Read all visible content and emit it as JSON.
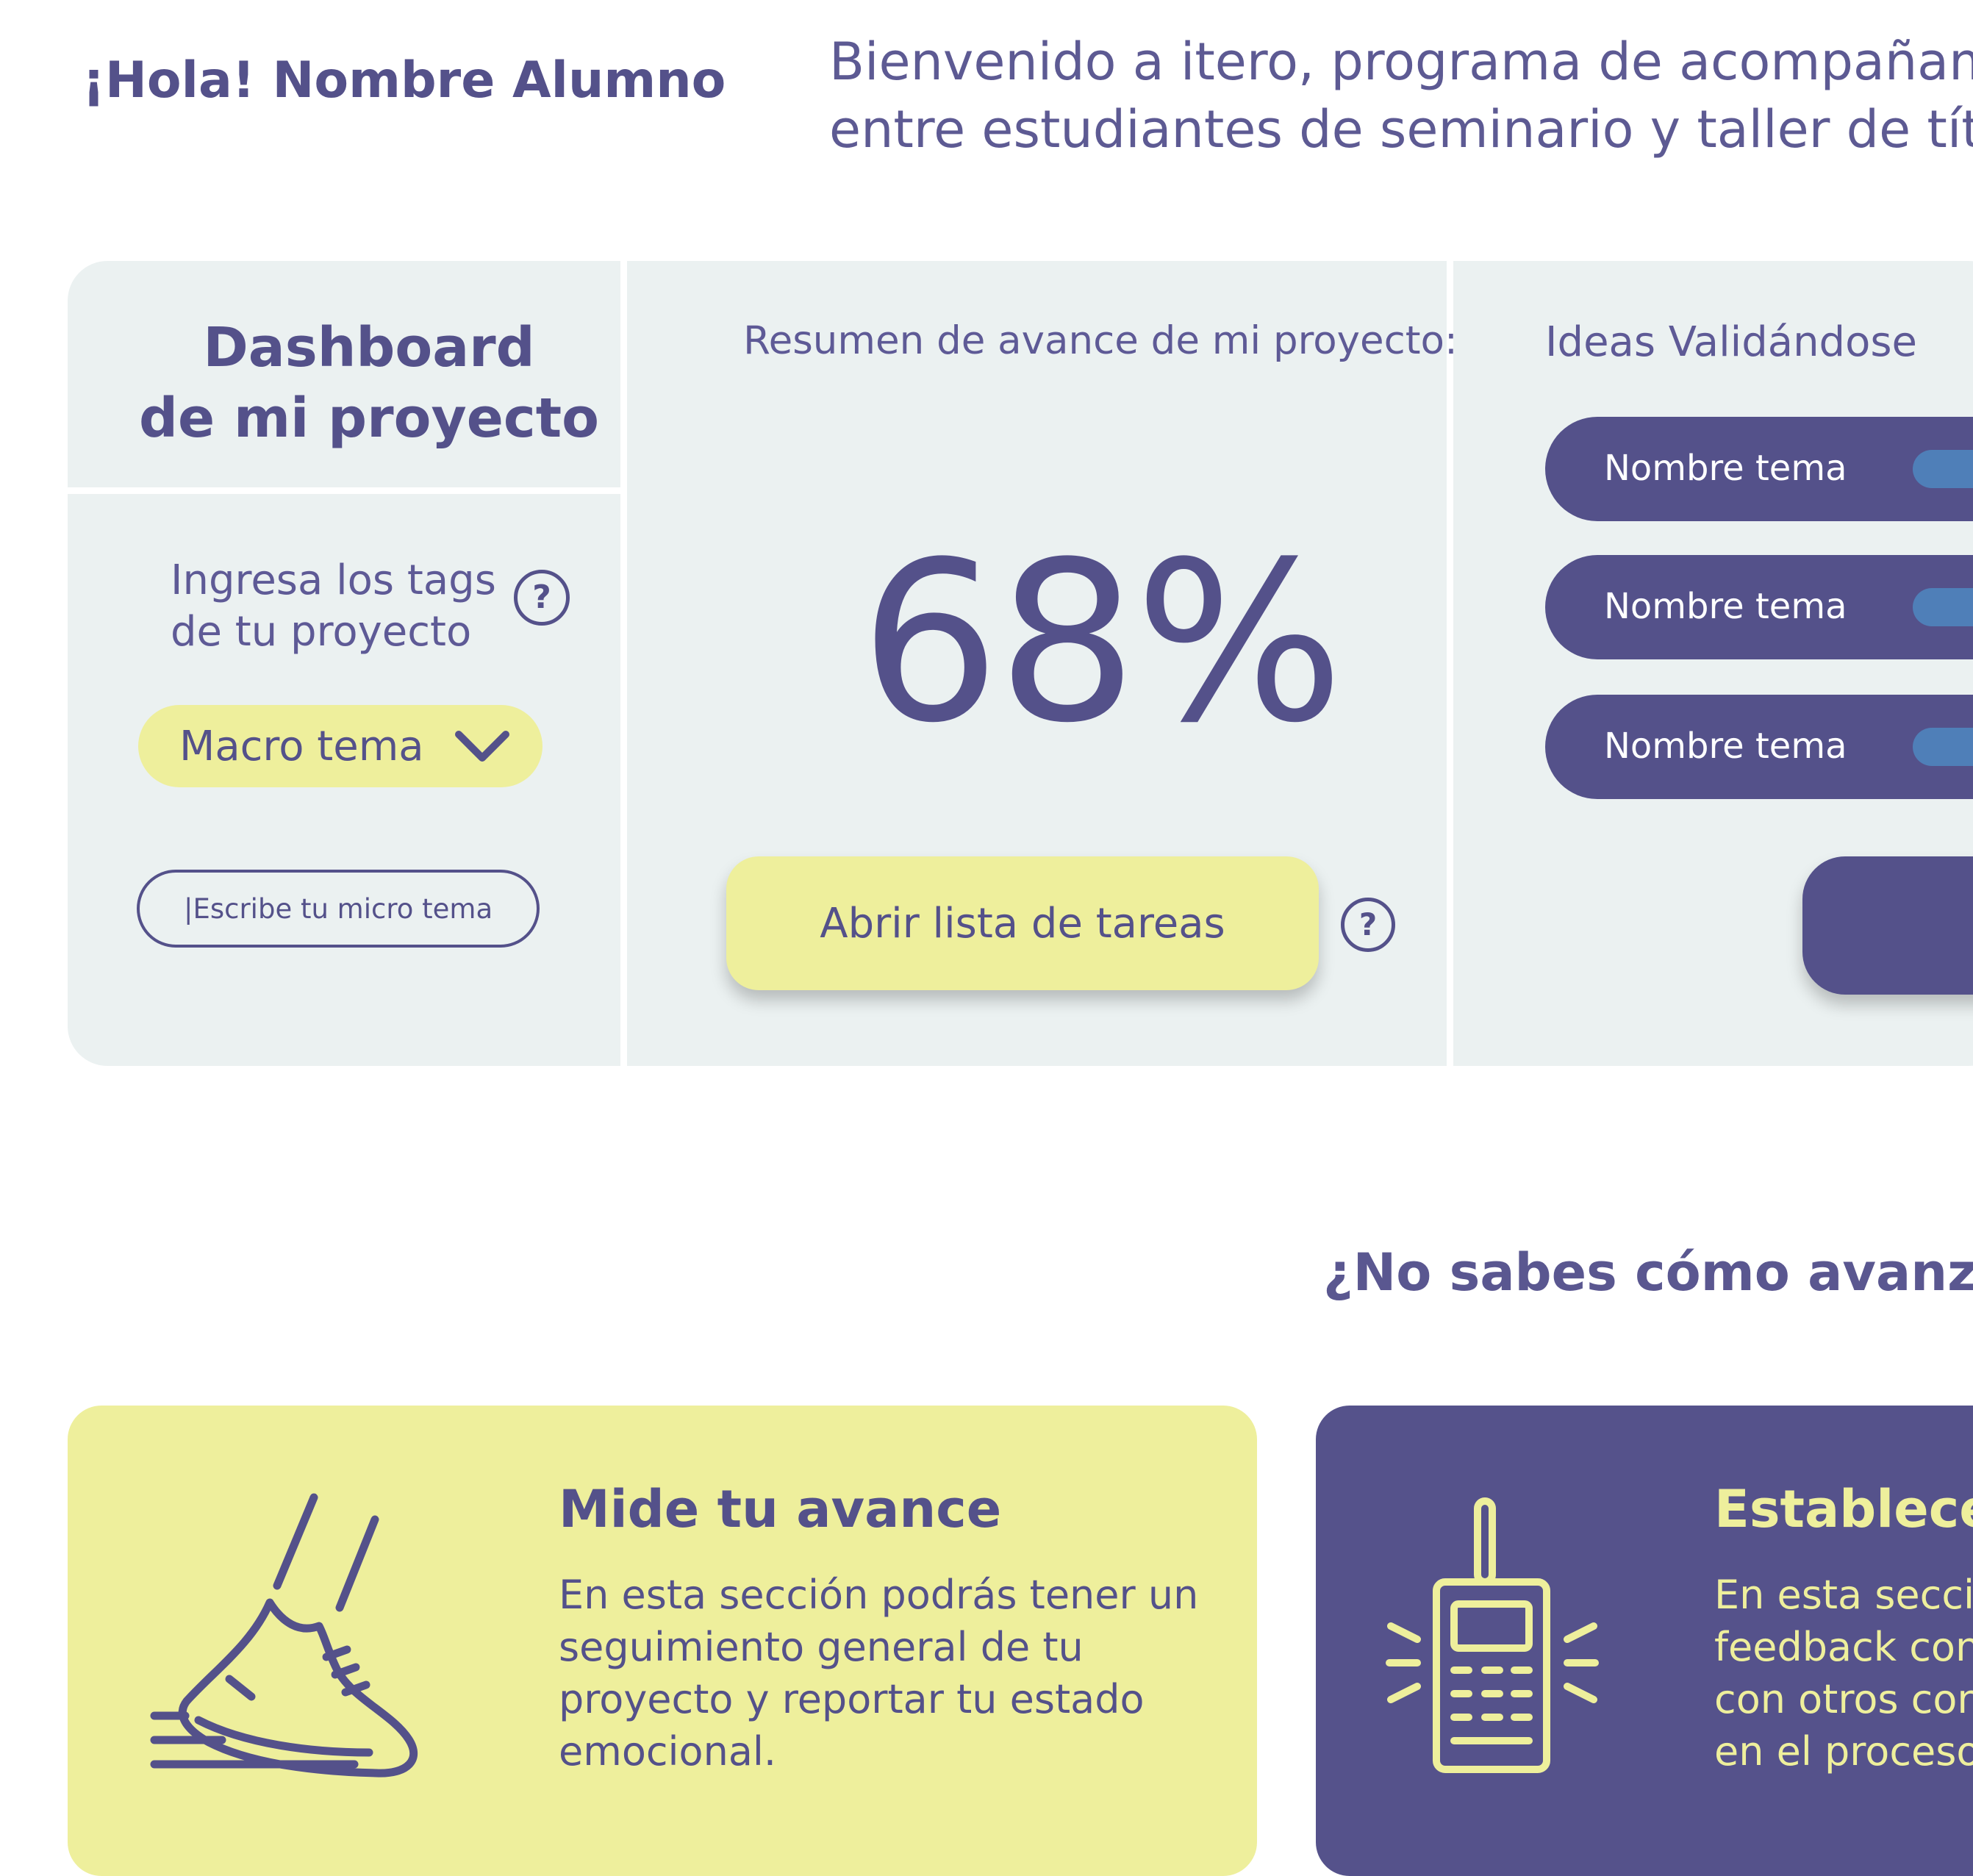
{
  "header": {
    "greeting": "¡Hola! Nombre Alumno",
    "welcome_line1": "Bienvenido a itero, programa de acompañam",
    "welcome_line2": "entre estudiantes de seminario y taller de títu"
  },
  "dashboard": {
    "title_line1": "Dashboard",
    "title_line2": "de mi proyecto",
    "tags_label_line1": "Ingresa los tags",
    "tags_label_line2": "de tu proyecto",
    "help_glyph": "?",
    "macro_select_value": "Macro tema",
    "micro_input_placeholder": "|Escribe tu micro tema",
    "summary_title": "Resumen de avance de mi proyecto:",
    "progress_percent": "68%",
    "tasks_button": "Abrir lista de tareas",
    "ideas_title": "Ideas Validándose",
    "ideas": [
      {
        "label": "Nombre tema"
      },
      {
        "label": "Nombre tema"
      },
      {
        "label": "Nombre tema"
      }
    ]
  },
  "question": "¿No sabes cómo avanzar",
  "cards": {
    "measure": {
      "title": "Mide tu avance",
      "text_line1": "En esta sección podrás tener un",
      "text_line2": "seguimiento general de tu",
      "text_line3": "proyecto y reportar tu estado",
      "text_line4": "emocional.",
      "icon": "running-shoe-icon"
    },
    "connect": {
      "title": "Establece",
      "text_line1": "En esta secci",
      "text_line2": "feedback con",
      "text_line3": "con otros con",
      "text_line4": "en el proceso",
      "icon": "walkie-talkie-icon"
    }
  },
  "colors": {
    "primary": "#54518a",
    "accent_yellow": "#eeef9c",
    "panel_bg": "#ebf1f1",
    "toggle_blue": "#4f7fb8"
  }
}
